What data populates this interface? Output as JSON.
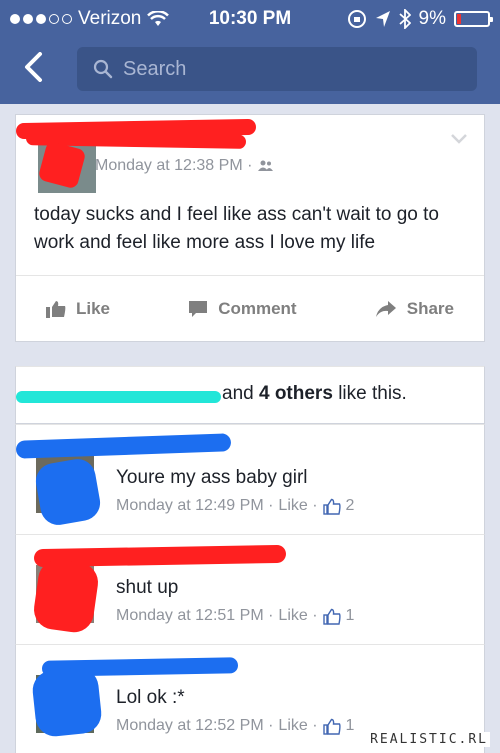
{
  "status_bar": {
    "carrier": "Verizon",
    "time": "10:30 PM",
    "battery": "9%"
  },
  "nav": {
    "search_placeholder": "Search"
  },
  "post": {
    "timestamp": "Monday at 12:38 PM ·",
    "text": "today sucks and I feel like ass can't wait to go to work and feel like more ass I love my life",
    "actions": {
      "like": "Like",
      "comment": "Comment",
      "share": "Share"
    },
    "likes_prefix": "and",
    "likes_bold": "4 others",
    "likes_suffix": "like this."
  },
  "comments": [
    {
      "text": "Youre my ass baby girl",
      "time": "Monday at 12:49 PM ·",
      "like": "Like ·",
      "count": "2"
    },
    {
      "text": "shut up",
      "time": "Monday at 12:51 PM ·",
      "like": "Like ·",
      "count": "1"
    },
    {
      "text": "Lol ok :*",
      "time": "Monday at 12:52 PM ·",
      "like": "Like ·",
      "count": "1"
    }
  ],
  "watermark": "REALISTIC.RL",
  "colors": {
    "nav_blue": "#47639e",
    "redaction_red": "#ff2020",
    "redaction_blue": "#1c6ef0",
    "redaction_cyan": "#22e6d8"
  }
}
